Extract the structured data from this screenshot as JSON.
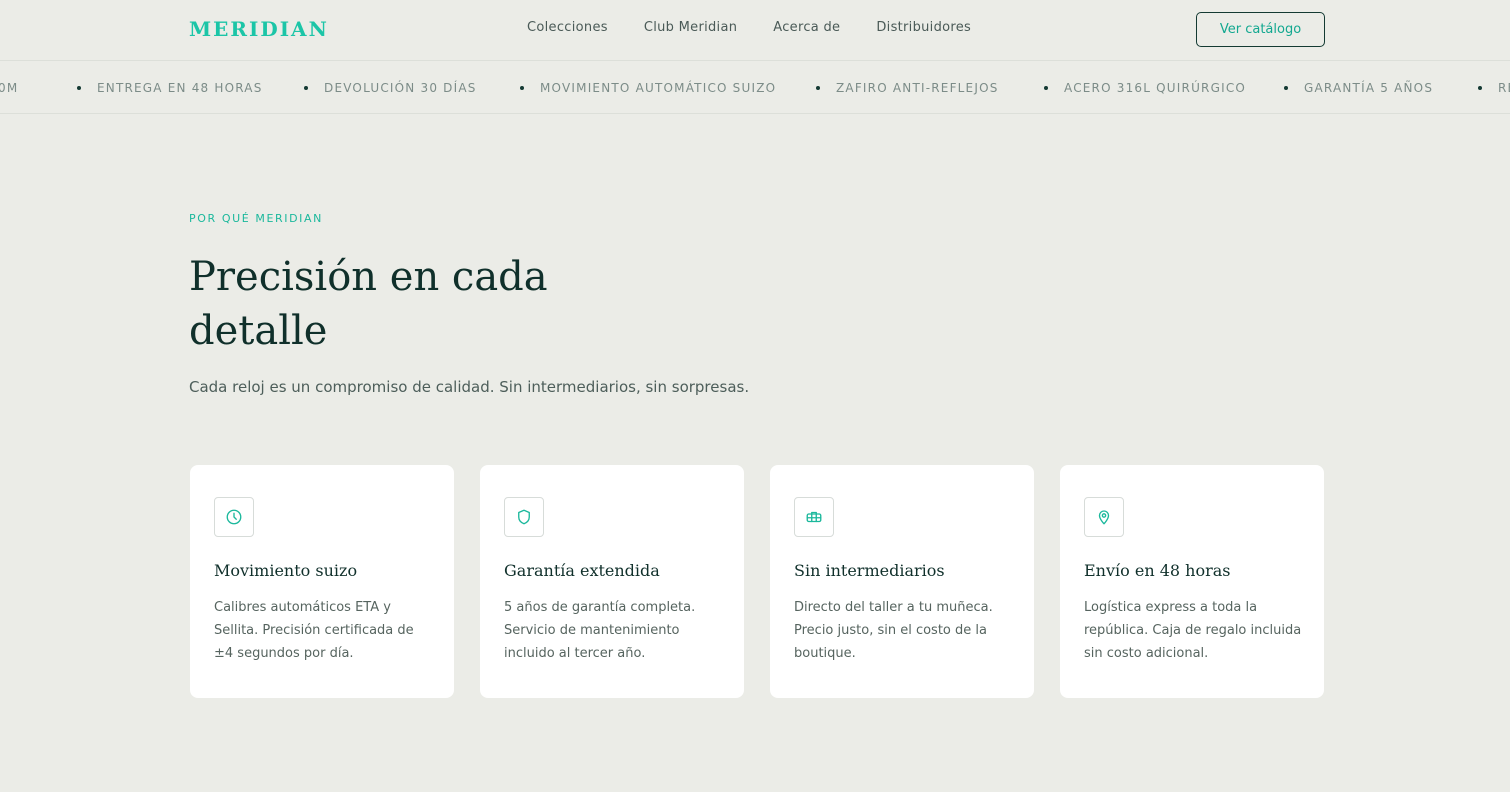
{
  "header": {
    "logo": "MERIDIAN",
    "nav": [
      "Colecciones",
      "Club Meridian",
      "Acerca de",
      "Distribuidores"
    ],
    "cta_label": "Ver catálogo"
  },
  "ticker": {
    "items": [
      "0M",
      "ENTREGA EN 48 HORAS",
      "DEVOLUCIÓN 30 DÍAS",
      "MOVIMIENTO AUTOMÁTICO SUIZO",
      "ZAFIRO ANTI-REFLEJOS",
      "ACERO 316L QUIRÚRGICO",
      "GARANTÍA 5 AÑOS",
      "RE"
    ]
  },
  "hero": {
    "eyebrow": "POR QUÉ MERIDIAN",
    "title": "Precisión en cada detalle",
    "subtitle": "Cada reloj es un compromiso de calidad. Sin intermediarios, sin sorpresas."
  },
  "features": [
    {
      "icon": "clock-icon",
      "title": "Movimiento suizo",
      "text": "Calibres automáticos ETA y Sellita. Precisión certificada de ±4 segundos por día."
    },
    {
      "icon": "shield-icon",
      "title": "Garantía extendida",
      "text": "5 años de garantía completa. Servicio de mantenimiento incluido al tercer año."
    },
    {
      "icon": "handshake-icon",
      "title": "Sin intermediarios",
      "text": "Directo del taller a tu muñeca. Precio justo, sin el costo de la boutique."
    },
    {
      "icon": "map-pin-icon",
      "title": "Envío en 48 horas",
      "text": "Logística express a toda la república. Caja de regalo incluida sin costo adicional."
    }
  ],
  "colors": {
    "accent": "#1bc5a7",
    "dark": "#10302b",
    "background": "#ebece7",
    "card": "#ffffff"
  }
}
